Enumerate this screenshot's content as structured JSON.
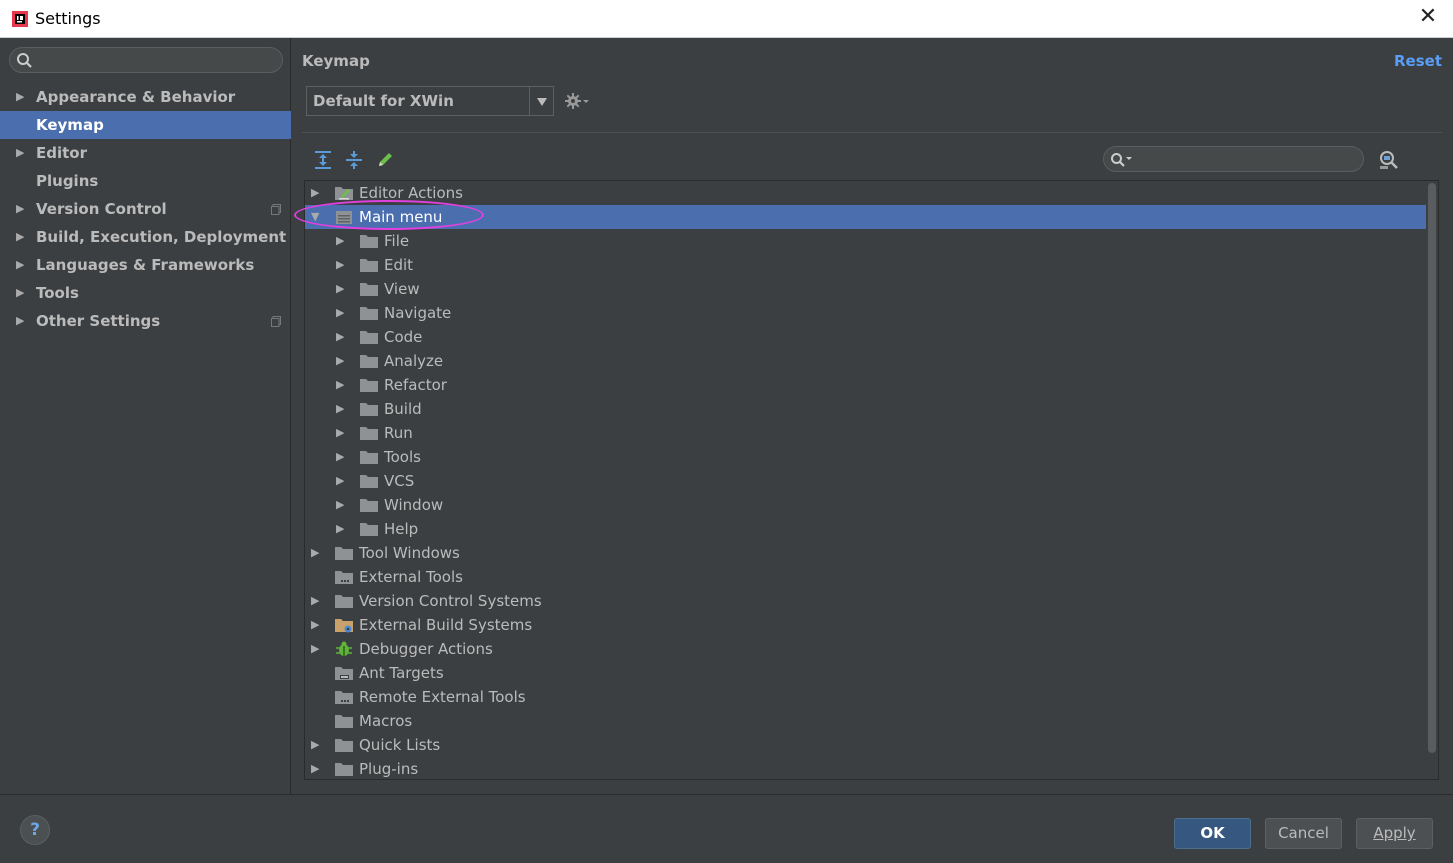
{
  "window": {
    "title": "Settings"
  },
  "sidebar": {
    "search_placeholder": "",
    "items": [
      {
        "label": "Appearance & Behavior",
        "expandable": true
      },
      {
        "label": "Keymap",
        "expandable": false,
        "selected": true
      },
      {
        "label": "Editor",
        "expandable": true
      },
      {
        "label": "Plugins",
        "expandable": false
      },
      {
        "label": "Version Control",
        "expandable": true,
        "project_icon": true
      },
      {
        "label": "Build, Execution, Deployment",
        "expandable": true
      },
      {
        "label": "Languages & Frameworks",
        "expandable": true
      },
      {
        "label": "Tools",
        "expandable": true
      },
      {
        "label": "Other Settings",
        "expandable": true,
        "project_icon": true
      }
    ]
  },
  "main": {
    "title": "Keymap",
    "reset_label": "Reset",
    "keymap_value": "Default for XWin",
    "filter_placeholder": ""
  },
  "tree": {
    "rows": [
      {
        "label": "Editor Actions",
        "level": 0,
        "expander": "collapsed",
        "icon": "editor-actions-icon"
      },
      {
        "label": "Main menu",
        "level": 0,
        "expander": "expanded",
        "icon": "main-menu-icon",
        "selected": true
      },
      {
        "label": "File",
        "level": 1,
        "expander": "collapsed",
        "icon": "folder-icon"
      },
      {
        "label": "Edit",
        "level": 1,
        "expander": "collapsed",
        "icon": "folder-icon"
      },
      {
        "label": "View",
        "level": 1,
        "expander": "collapsed",
        "icon": "folder-icon"
      },
      {
        "label": "Navigate",
        "level": 1,
        "expander": "collapsed",
        "icon": "folder-icon"
      },
      {
        "label": "Code",
        "level": 1,
        "expander": "collapsed",
        "icon": "folder-icon"
      },
      {
        "label": "Analyze",
        "level": 1,
        "expander": "collapsed",
        "icon": "folder-icon"
      },
      {
        "label": "Refactor",
        "level": 1,
        "expander": "collapsed",
        "icon": "folder-icon"
      },
      {
        "label": "Build",
        "level": 1,
        "expander": "collapsed",
        "icon": "folder-icon"
      },
      {
        "label": "Run",
        "level": 1,
        "expander": "collapsed",
        "icon": "folder-icon"
      },
      {
        "label": "Tools",
        "level": 1,
        "expander": "collapsed",
        "icon": "folder-icon"
      },
      {
        "label": "VCS",
        "level": 1,
        "expander": "collapsed",
        "icon": "folder-icon"
      },
      {
        "label": "Window",
        "level": 1,
        "expander": "collapsed",
        "icon": "folder-icon"
      },
      {
        "label": "Help",
        "level": 1,
        "expander": "collapsed",
        "icon": "folder-icon"
      },
      {
        "label": "Tool Windows",
        "level": 0,
        "expander": "collapsed",
        "icon": "folder-icon"
      },
      {
        "label": "External Tools",
        "level": 0,
        "expander": "none",
        "icon": "external-tools-icon"
      },
      {
        "label": "Version Control Systems",
        "level": 0,
        "expander": "collapsed",
        "icon": "folder-icon"
      },
      {
        "label": "External Build Systems",
        "level": 0,
        "expander": "collapsed",
        "icon": "external-build-icon"
      },
      {
        "label": "Debugger Actions",
        "level": 0,
        "expander": "collapsed",
        "icon": "debugger-bug-icon"
      },
      {
        "label": "Ant Targets",
        "level": 0,
        "expander": "none",
        "icon": "ant-targets-icon"
      },
      {
        "label": "Remote External Tools",
        "level": 0,
        "expander": "none",
        "icon": "external-tools-icon"
      },
      {
        "label": "Macros",
        "level": 0,
        "expander": "none",
        "icon": "folder-icon"
      },
      {
        "label": "Quick Lists",
        "level": 0,
        "expander": "collapsed",
        "icon": "folder-icon"
      },
      {
        "label": "Plug-ins",
        "level": 0,
        "expander": "collapsed",
        "icon": "folder-icon"
      }
    ]
  },
  "footer": {
    "help_label": "?",
    "ok_label": "OK",
    "cancel_label": "Cancel",
    "apply_label": "Apply"
  },
  "colors": {
    "background": "#3c3f41",
    "selection": "#4b6eaf",
    "link": "#589df6",
    "highlight_ellipse": "#e040e0"
  }
}
